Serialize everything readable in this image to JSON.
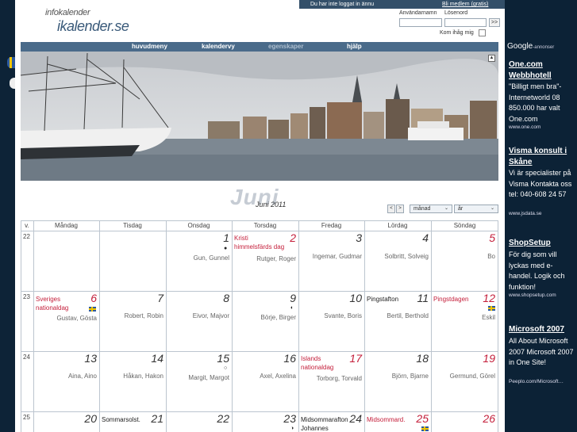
{
  "site": {
    "logo_top": "infokalender",
    "logo_main": "ikalender.se"
  },
  "login": {
    "status": "Du har inte loggat in ännu",
    "member_link": "Bli medlem (gratis)",
    "username_label": "Användarnamn",
    "password_label": "Lösenord",
    "go_label": ">>",
    "remember_label": "Kom ihåg mig"
  },
  "nav": [
    "huvudmeny",
    "kalendervy",
    "egenskaper",
    "hjälp"
  ],
  "calendar": {
    "month_big": "Juni",
    "month_small": "Juni 2011",
    "prev": "<",
    "next": ">",
    "view_select": "månad",
    "year_select": "år",
    "headers": [
      "v.",
      "Måndag",
      "Tisdag",
      "Onsdag",
      "Torsdag",
      "Fredag",
      "Lördag",
      "Söndag"
    ],
    "weeks": [
      "22",
      "23",
      "24",
      "25"
    ],
    "days": {
      "d1": "1",
      "d2": "2",
      "d3": "3",
      "d4": "4",
      "d5": "5",
      "d6": "6",
      "d7": "7",
      "d8": "8",
      "d9": "9",
      "d10": "10",
      "d11": "11",
      "d12": "12",
      "d13": "13",
      "d14": "14",
      "d15": "15",
      "d16": "16",
      "d17": "17",
      "d18": "18",
      "d19": "19",
      "d20": "20",
      "d21": "21",
      "d22": "22",
      "d23": "23",
      "d24": "24",
      "d25": "25",
      "d26": "26"
    },
    "names": {
      "d1": "Gun, Gunnel",
      "d2": "Rutger, Roger",
      "d3": "Ingemar, Gudmar",
      "d4": "Solbritt, Solveig",
      "d5": "Bo",
      "d6": "Gustav, Gösta",
      "d7": "Robert, Robin",
      "d8": "Eivor, Majvor",
      "d9": "Börje, Birger",
      "d10": "Svante, Boris",
      "d11": "Bertil, Berthold",
      "d12": "Eskil",
      "d13": "Aina, Aino",
      "d14": "Håkan, Hakon",
      "d15": "Margit, Margot",
      "d16": "Axel, Axelina",
      "d17": "Torborg, Torvald",
      "d18": "Björn, Bjarne",
      "d19": "Germund, Görel"
    },
    "holidays": {
      "d2": "Kristi himmelsfärds dag",
      "d6": "Sveriges nationaldag",
      "d11": "Pingstafton",
      "d12": "Pingstdagen",
      "d17": "Islands nationaldag",
      "d21": "Sommarsolst.",
      "d24": "Midsommarafton Johannes",
      "d25": "Midsommard."
    },
    "moons": {
      "m1": "●",
      "m9": "◐",
      "m15": "○",
      "m23": "◑"
    }
  },
  "ads": {
    "header": "Google",
    "header_suffix": "-annonser",
    "items": [
      {
        "title": "One.com Webbhotell",
        "text": "\"Billigt men bra\"- Internetworld 08 850.000 har valt One.com",
        "url": "www.one.com"
      },
      {
        "title": "Visma konsult i Skåne",
        "text": "Vi är specialister på Visma Kontakta oss tel: 040-608 24 57",
        "url": "www.jsdata.se"
      },
      {
        "title": "ShopSetup",
        "text": "För dig som vill lyckas med e-handel. Logik och funktion!",
        "url": "www.shopsetup.com"
      },
      {
        "title": "Microsoft 2007",
        "text": "All About Microsoft 2007 Microsoft 2007 in One Site!",
        "url": "Peeplo.com/Microsoft…"
      }
    ]
  },
  "colors": {
    "nav_bg": "#4a6b8a",
    "sidebar_bg": "#0c2236",
    "holiday_red": "#c41e3a"
  }
}
